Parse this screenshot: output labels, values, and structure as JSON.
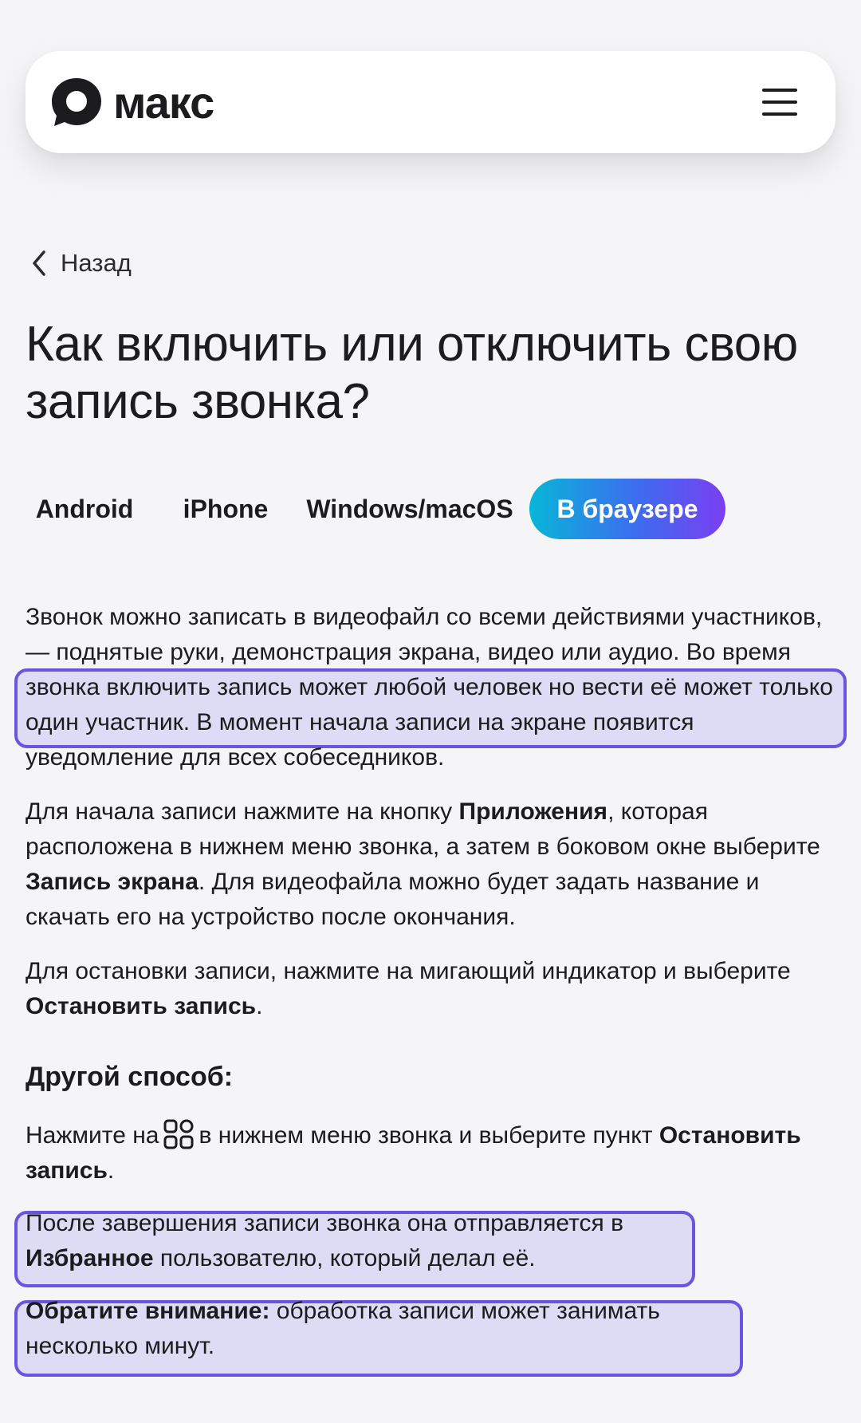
{
  "header": {
    "logo_text": "макс",
    "logo_icon": "max-logo-icon",
    "menu_icon": "hamburger-menu-icon"
  },
  "nav": {
    "back_label": "Назад",
    "back_icon": "chevron-left-icon"
  },
  "page_title": "Как включить или отключить свою запись звонка?",
  "tabs": [
    {
      "label": "Android",
      "active": false
    },
    {
      "label": "iPhone",
      "active": false
    },
    {
      "label": "Windows/macOS",
      "active": false
    },
    {
      "label": "В браузере",
      "active": true
    }
  ],
  "content": {
    "p1": "Звонок можно записать в видеофайл со всеми действиями участников, — поднятые руки, демонстрация экрана, видео или аудио. Во время звонка включить запись может любой человек но вести её может только один участник. В момент начала записи на экране появится уведомление для всех собеседников.",
    "p2_before": "Для начала записи нажмите на кнопку ",
    "p2_bold1": "Приложения",
    "p2_middle": ", которая расположена в нижнем меню звонка, а затем в боковом окне выберите ",
    "p2_bold2": "Запись экрана",
    "p2_after": ". Для видеофайла можно будет задать название и скачать его на устройство после окончания.",
    "p3_before": "Для остановки записи, нажмите на мигающий индикатор и выберите ",
    "p3_bold": "Остановить запись",
    "p3_after": ".",
    "subheading": "Другой способ:",
    "p4_before": "Нажмите на",
    "p4_icon": "apps-grid-icon",
    "p4_middle": "в нижнем меню звонка и выберите пункт ",
    "p4_bold": "Остановить запись",
    "p4_after": ".",
    "p5_before": "После завершения записи звонка она отправляется в ",
    "p5_bold": "Избранное",
    "p5_after": " пользователю, который делал её.",
    "p6_bold": "Обратите внимание:",
    "p6_after": " обработка записи может занимать несколько минут."
  },
  "colors": {
    "background": "#f5f5f7",
    "text": "#1c1c1f",
    "active_tab_gradient": [
      "#07b6d8",
      "#3d6cf0",
      "#7a3ff2"
    ],
    "highlight_border": "#6b55e0"
  }
}
